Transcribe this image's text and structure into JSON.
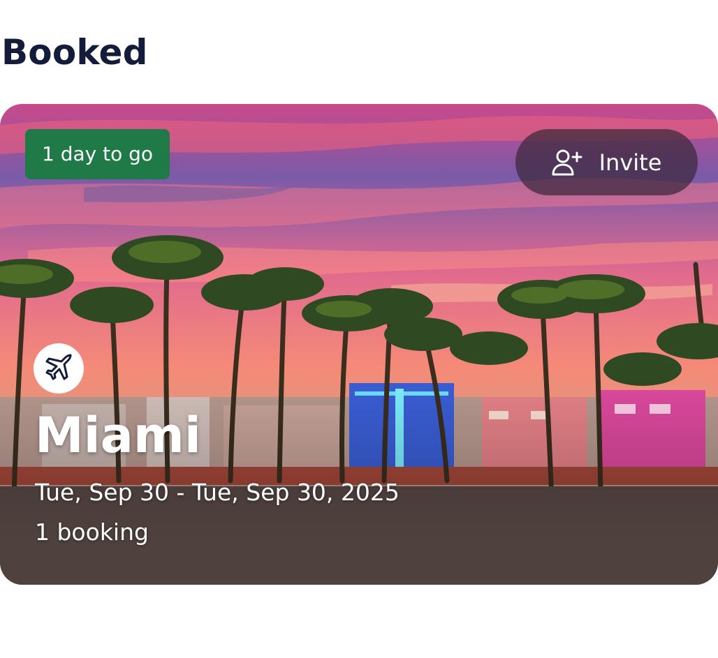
{
  "section": {
    "title": "Booked"
  },
  "trip": {
    "countdown_badge": "1 day to go",
    "invite_label": "Invite",
    "city": "Miami",
    "dates": "Tue, Sep 30 - Tue, Sep 30, 2025",
    "booking_count": "1 booking",
    "type_icon": "airplane-icon",
    "invite_icon": "person-add-icon",
    "image_subject": "Miami Beach Ocean Drive palm trees at sunset"
  },
  "colors": {
    "title": "#141c3c",
    "badge_background": "#1f7a47",
    "invite_background": "#3a283c",
    "text_on_image": "#ffffff"
  }
}
